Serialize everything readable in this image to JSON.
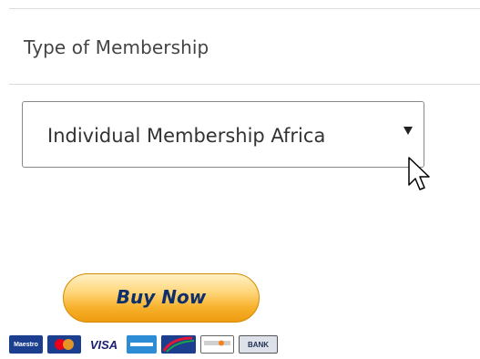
{
  "membership": {
    "label": "Type of Membership",
    "selected_value": "Individual Membership Africa",
    "arrow_icon": "dropdown-arrow-icon"
  },
  "payment": {
    "buy_now_label": "Buy Now",
    "cards": [
      {
        "name": "maestro",
        "text": "Maestro"
      },
      {
        "name": "mastercard",
        "text": "MasterCard"
      },
      {
        "name": "visa",
        "text": "VISA"
      },
      {
        "name": "amex",
        "text": "AMEX"
      },
      {
        "name": "clickandbuy",
        "text": "ClassicPay"
      },
      {
        "name": "discover",
        "text": "DISCOVER"
      },
      {
        "name": "bank",
        "text": "BANK"
      }
    ]
  },
  "colors": {
    "button_gradient_top": "#fff1c6",
    "button_gradient_bottom": "#ee9c10",
    "button_text": "#0d2f6b",
    "label_text": "#444444",
    "border": "#888888"
  }
}
